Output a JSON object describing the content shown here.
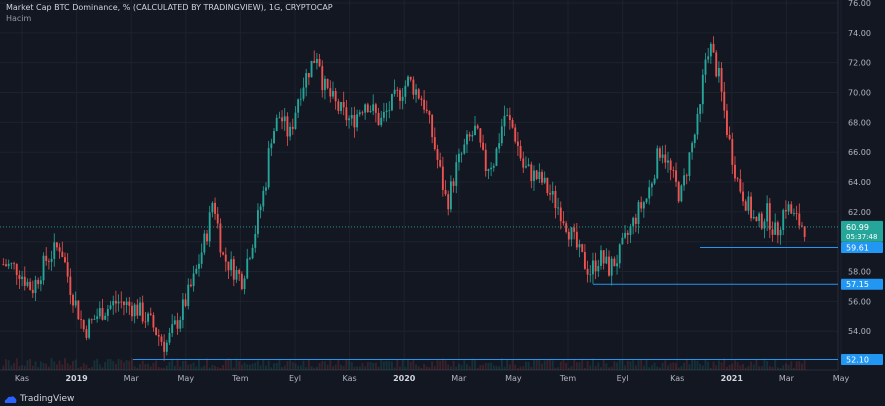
{
  "header": {
    "title": "Market Cap BTC Dominance, % (CALCULATED BY TRADINGVIEW), 1G, CRYPTOCAP",
    "volume_label": "Hacim"
  },
  "branding": {
    "name": "TradingView"
  },
  "chart_data": {
    "type": "candlestick",
    "y_axis": {
      "ticks": [
        54.0,
        56.0,
        58.0,
        60.0,
        62.0,
        64.0,
        66.0,
        68.0,
        70.0,
        72.0,
        74.0,
        76.0
      ],
      "ylim": [
        51.4,
        76.2
      ],
      "side": "right"
    },
    "x_axis": {
      "ticks": [
        "Kas",
        "2019",
        "Mar",
        "May",
        "Tem",
        "Eyl",
        "Kas",
        "2020",
        "Mar",
        "May",
        "Tem",
        "Eyl",
        "Kas",
        "2021",
        "Mar",
        "May"
      ],
      "bold_ticks": [
        "2019",
        "2020",
        "2021"
      ]
    },
    "current_price": {
      "value": "60.99",
      "countdown": "05:37:48"
    },
    "horizontal_lines": [
      {
        "value": 59.61,
        "label": "59.61"
      },
      {
        "value": 57.15,
        "label": "57.15"
      },
      {
        "value": 52.1,
        "label": "52.10"
      }
    ],
    "price_path": [
      [
        0,
        58.5
      ],
      [
        3,
        58.2
      ],
      [
        6,
        56.8
      ],
      [
        9,
        58.8
      ],
      [
        12,
        59.8
      ],
      [
        14,
        57.0
      ],
      [
        17,
        54.0
      ],
      [
        20,
        55.2
      ],
      [
        24,
        56.0
      ],
      [
        28,
        55.5
      ],
      [
        31,
        54.5
      ],
      [
        34,
        53.0
      ],
      [
        37,
        55.0
      ],
      [
        40,
        57.5
      ],
      [
        43,
        61.0
      ],
      [
        44,
        63.0
      ],
      [
        46,
        59.0
      ],
      [
        50,
        57.5
      ],
      [
        53,
        61.0
      ],
      [
        55,
        64.0
      ],
      [
        56,
        67.0
      ],
      [
        58,
        68.5
      ],
      [
        60,
        67.0
      ],
      [
        62,
        70.0
      ],
      [
        64,
        71.5
      ],
      [
        66,
        72.8
      ],
      [
        67,
        70.5
      ],
      [
        70,
        69.0
      ],
      [
        73,
        68.0
      ],
      [
        76,
        69.5
      ],
      [
        79,
        68.0
      ],
      [
        82,
        69.5
      ],
      [
        85,
        70.8
      ],
      [
        88,
        69.5
      ],
      [
        90,
        67.0
      ],
      [
        92,
        64.0
      ],
      [
        93,
        62.5
      ],
      [
        95,
        65.0
      ],
      [
        97,
        66.5
      ],
      [
        99,
        67.5
      ],
      [
        101,
        65.0
      ],
      [
        103,
        65.5
      ],
      [
        105,
        68.5
      ],
      [
        107,
        67.5
      ],
      [
        109,
        65.0
      ],
      [
        111,
        64.5
      ],
      [
        113,
        64.0
      ],
      [
        115,
        63.0
      ],
      [
        117,
        62.0
      ],
      [
        119,
        60.5
      ],
      [
        121,
        59.0
      ],
      [
        123,
        58.0
      ],
      [
        125,
        59.0
      ],
      [
        127,
        58.2
      ],
      [
        129,
        59.0
      ],
      [
        131,
        60.5
      ],
      [
        133,
        62.0
      ],
      [
        135,
        63.0
      ],
      [
        137,
        65.5
      ],
      [
        138,
        66.5
      ],
      [
        140,
        64.5
      ],
      [
        142,
        63.0
      ],
      [
        144,
        66.0
      ],
      [
        146,
        68.5
      ],
      [
        147,
        72.0
      ],
      [
        148,
        73.3
      ],
      [
        150,
        71.0
      ],
      [
        152,
        67.0
      ],
      [
        154,
        64.0
      ],
      [
        156,
        62.5
      ],
      [
        158,
        61.0
      ],
      [
        160,
        62.0
      ],
      [
        162,
        60.5
      ],
      [
        164,
        62.5
      ],
      [
        166,
        61.5
      ],
      [
        168,
        61.0
      ]
    ],
    "volume": "low bars along bottom"
  }
}
